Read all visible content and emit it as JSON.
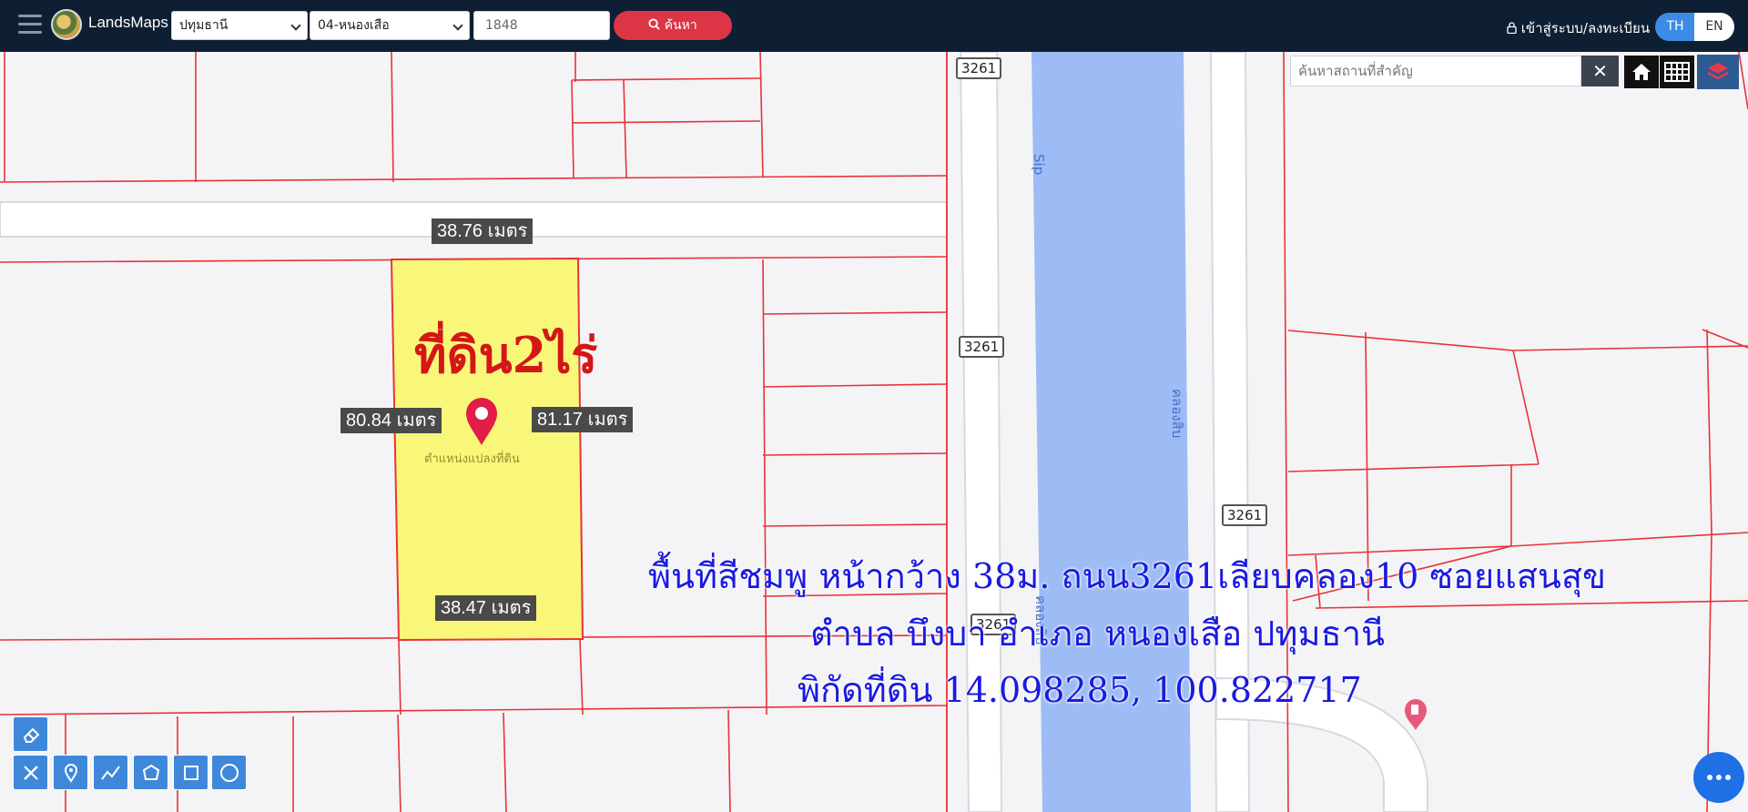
{
  "app": {
    "brand": "LandsMaps"
  },
  "header": {
    "province": "ปทุมธานี",
    "district": "04-หนองเสือ",
    "parcel_number": "1848",
    "search_label": "ค้นหา",
    "login_label": "เข้าสู่ระบบ/ลงทะเบียน",
    "lang_th": "TH",
    "lang_en": "EN"
  },
  "map": {
    "poi_search_placeholder": "ค้นหาสถานที่สำคัญ",
    "poi_clear": "✕",
    "dimensions": {
      "top": "38.76 เมตร",
      "left": "80.84 เมตร",
      "right": "81.17 เมตร",
      "bottom": "38.47 เมตร"
    },
    "land_title": "ที่ดิน2ไร่",
    "pin_caption": "ตำแหน่งแปลงที่ดิน",
    "route_number": "3261",
    "canal_top_label": "Sip",
    "canal_label": "คลองสิบ",
    "canal_label_lower": "คลองสิบ",
    "overlay_lines": [
      "พื้นที่สีชมพู หน้ากว้าง 38ม. ถนน3261เลียบคลอง10 ซอยแสนสุข",
      "ตำบล บึงบา อำเภอ หนองเสือ ปทุมธานี",
      "พิกัดที่ดิน 14.098285, 100.822717"
    ]
  },
  "icons": {
    "menu": "hamburger-icon",
    "home": "home-icon",
    "grid": "grid-icon",
    "layers": "layers-icon",
    "search": "search-icon",
    "lock": "lock-icon",
    "pin": "map-pin-icon",
    "fuel": "fuel-station-icon",
    "more": "more-dots-icon"
  },
  "colors": {
    "topbar": "#0f1f33",
    "parcel_fill": "#f9f77a",
    "parcel_lines": "#e8333a",
    "canal": "#9dbcf5",
    "search_button": "#dc3545",
    "overlay_text": "#1a1ae0",
    "title_text": "#d31717"
  }
}
